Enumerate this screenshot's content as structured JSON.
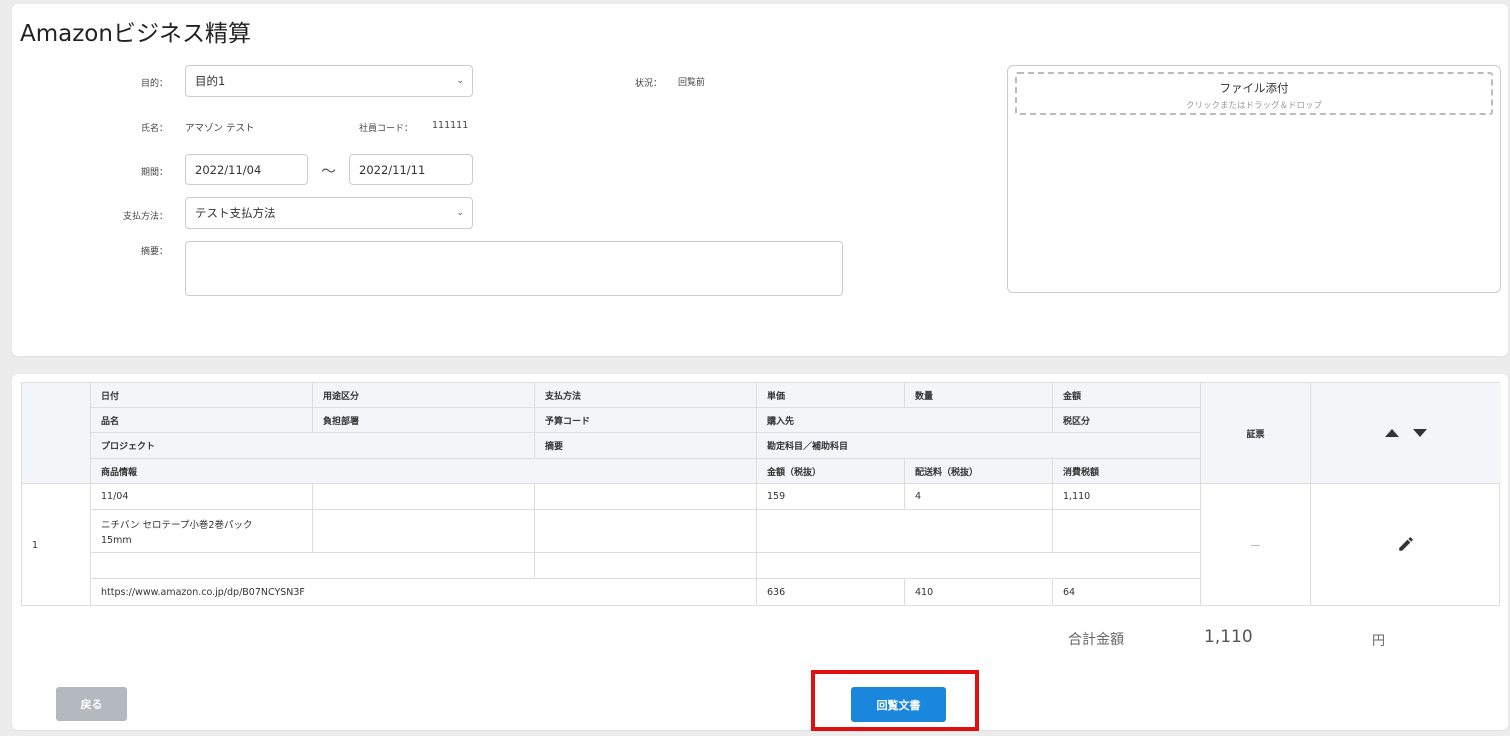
{
  "page": {
    "title": "Amazonビジネス精算"
  },
  "form": {
    "purpose_label": "目的：",
    "purpose_value": "目的1",
    "status_label": "状況：",
    "status_value": "回覧前",
    "name_label": "氏名：",
    "name_value": "アマゾン テスト",
    "employee_code_label": "社員コード：",
    "employee_code_value": "111111",
    "period_label": "期間：",
    "period_start": "2022/11/04",
    "period_sep": "～",
    "period_end": "2022/11/11",
    "payment_label": "支払方法：",
    "payment_value": "テスト支払方法",
    "summary_label": "摘要：",
    "summary_value": ""
  },
  "attachment": {
    "title": "ファイル添付",
    "subtitle": "クリックまたはドラッグ＆ドロップ"
  },
  "table": {
    "headers": {
      "date": "日付",
      "usage": "用途区分",
      "payment": "支払方法",
      "unit_price": "単価",
      "quantity": "数量",
      "amount": "金額",
      "item_name": "品名",
      "department": "負担部署",
      "budget_code": "予算コード",
      "vendor": "購入先",
      "tax_category": "税区分",
      "project": "プロジェクト",
      "summary": "摘要",
      "account": "勘定科目／補助科目",
      "product_info": "商品情報",
      "amount_excl_tax": "金額（税抜）",
      "shipping_excl_tax": "配送料（税抜）",
      "consumption_tax": "消費税額",
      "receipt": "証票"
    },
    "rows": [
      {
        "no": "1",
        "date": "11/04",
        "unit_price": "159",
        "quantity": "4",
        "amount": "1,110",
        "item_name_line1": "ニチバン セロテープ小巻2巻パック",
        "item_name_line2": "15mm",
        "product_url": "https://www.amazon.co.jp/dp/B07NCYSN3F",
        "amount_excl_tax": "636",
        "shipping_excl_tax": "410",
        "consumption_tax": "64",
        "receipt": "—"
      }
    ]
  },
  "totals": {
    "label": "合計金額",
    "value": "1,110",
    "unit": "円"
  },
  "buttons": {
    "back": "戻る",
    "circulate": "回覧文書"
  }
}
